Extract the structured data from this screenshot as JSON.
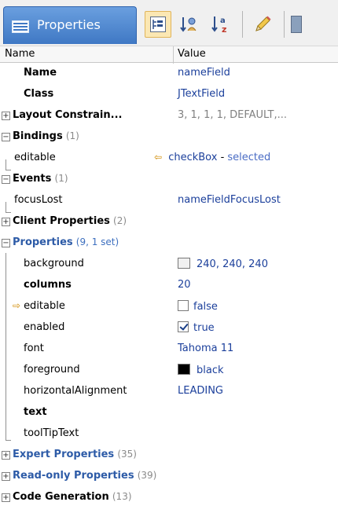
{
  "window": {
    "title": "Properties",
    "toolbar": [
      {
        "name": "categorized-view-button",
        "icon": "categorized-icon",
        "active": true
      },
      {
        "name": "sort-by-category-button",
        "icon": "sort-category-icon",
        "active": false
      },
      {
        "name": "sort-alphabetical-button",
        "icon": "sort-az-icon",
        "active": false
      },
      {
        "name": "edit-button",
        "icon": "pencil-icon",
        "active": false
      }
    ]
  },
  "header": {
    "name": "Name",
    "value": "Value"
  },
  "rows": {
    "name": {
      "label": "Name",
      "value": "nameField"
    },
    "class": {
      "label": "Class",
      "value": "JTextField"
    },
    "layout": {
      "label": "Layout Constrain...",
      "value": "3, 1, 1, 1, DEFAULT,..."
    },
    "bindings": {
      "label": "Bindings",
      "count": "(1)"
    },
    "bind_editable": {
      "label": "editable",
      "value_main": "checkBox",
      "value_dash": " - ",
      "value_sel": "selected"
    },
    "events": {
      "label": "Events",
      "count": "(1)"
    },
    "focuslost": {
      "label": "focusLost",
      "value": "nameFieldFocusLost"
    },
    "client": {
      "label": "Client Properties",
      "count": "(2)"
    },
    "properties": {
      "label": "Properties",
      "count": "(9, 1 set)"
    },
    "background": {
      "label": "background",
      "value": "240, 240, 240"
    },
    "columns": {
      "label": "columns",
      "value": "20"
    },
    "editable": {
      "label": "editable",
      "value": "false"
    },
    "enabled": {
      "label": "enabled",
      "value": "true"
    },
    "font": {
      "label": "font",
      "value": "Tahoma 11"
    },
    "foreground": {
      "label": "foreground",
      "value": "black"
    },
    "halign": {
      "label": "horizontalAlignment",
      "value": "LEADING"
    },
    "text": {
      "label": "text",
      "value": ""
    },
    "tooltip": {
      "label": "toolTipText",
      "value": ""
    },
    "expert": {
      "label": "Expert Properties",
      "count": "(35)"
    },
    "readonly": {
      "label": "Read-only Properties",
      "count": "(39)"
    },
    "codegen": {
      "label": "Code Generation",
      "count": "(13)"
    }
  },
  "colors": {
    "title_gradient_top": "#6a9fdf",
    "title_gradient_bottom": "#3f78c4",
    "value_blue": "#1b3f9b",
    "category_blue": "#2d5ba7"
  }
}
